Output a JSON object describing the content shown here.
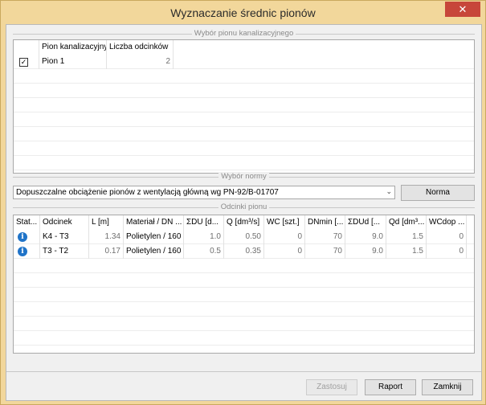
{
  "window": {
    "title": "Wyznaczanie średnic pionów",
    "close_glyph": "✕"
  },
  "group_pion": {
    "title": "Wybór pionu kanalizacyjnego",
    "columns": [
      "Pion kanalizacyjny",
      "Liczba odcinków"
    ],
    "rows": [
      {
        "checked": true,
        "check_glyph": "✓",
        "name": "Pion 1",
        "count": "2"
      }
    ]
  },
  "group_norma": {
    "title": "Wybór normy",
    "selected": "Dopuszczalne obciążenie pionów z wentylacją główną wg PN-92/B-01707",
    "arrow_glyph": "⌄",
    "button_label": "Norma"
  },
  "group_odcinki": {
    "title": "Odcinki pionu",
    "columns": [
      "Stat...",
      "Odcinek",
      "L [m]",
      "Materiał / DN ...",
      "ΣDU [d...",
      "Q [dm³/s]",
      "WC [szt.]",
      "DNmin [...",
      "ΣDUd [...",
      "Qd [dm³...",
      "WCdop ..."
    ],
    "info_glyph": "i",
    "rows": [
      {
        "odcinek": "K4 - T3",
        "l": "1.34",
        "material": "Polietylen / 160",
        "sdu": "1.0",
        "q": "0.50",
        "wc": "0",
        "dnmin": "70",
        "sdud": "9.0",
        "qd": "1.5",
        "wcdop": "0"
      },
      {
        "odcinek": "T3 - T2",
        "l": "0.17",
        "material": "Polietylen / 160",
        "sdu": "0.5",
        "q": "0.35",
        "wc": "0",
        "dnmin": "70",
        "sdud": "9.0",
        "qd": "1.5",
        "wcdop": "0"
      }
    ]
  },
  "buttons": {
    "apply": "Zastosuj",
    "report": "Raport",
    "close": "Zamknij"
  }
}
